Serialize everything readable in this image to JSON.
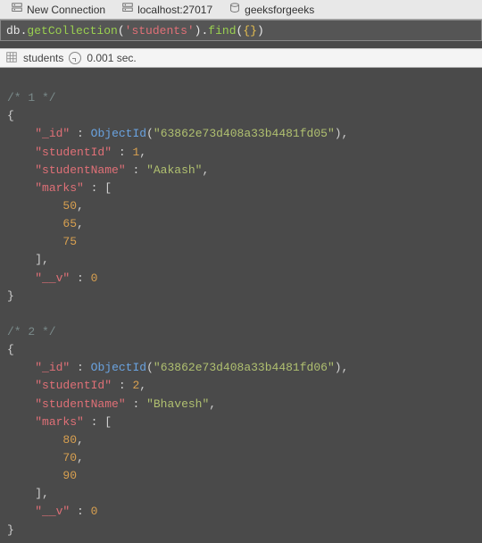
{
  "toolbar": {
    "new_connection": "New Connection",
    "host": "localhost:27017",
    "database": "geeksforgeeks"
  },
  "query": {
    "prefix": "db",
    "dot1": ".",
    "getcol": "getCollection",
    "p_open1": "(",
    "coll_q": "'students'",
    "p_close1": ")",
    "dot2": ".",
    "find": "find",
    "p_open2": "(",
    "braces": "{}",
    "p_close2": ")"
  },
  "status": {
    "collection": "students",
    "time": "0.001 sec."
  },
  "results": {
    "doc1": {
      "comment": "/* 1 */",
      "id_key": "\"_id\"",
      "id_func": "ObjectId",
      "id_val": "\"63862e73d408a33b4481fd05\"",
      "sid_key": "\"studentId\"",
      "sid_val": "1",
      "name_key": "\"studentName\"",
      "name_val": "\"Aakash\"",
      "marks_key": "\"marks\"",
      "m0": "50",
      "m1": "65",
      "m2": "75",
      "v_key": "\"__v\"",
      "v_val": "0"
    },
    "doc2": {
      "comment": "/* 2 */",
      "id_key": "\"_id\"",
      "id_func": "ObjectId",
      "id_val": "\"63862e73d408a33b4481fd06\"",
      "sid_key": "\"studentId\"",
      "sid_val": "2",
      "name_key": "\"studentName\"",
      "name_val": "\"Bhavesh\"",
      "marks_key": "\"marks\"",
      "m0": "80",
      "m1": "70",
      "m2": "90",
      "v_key": "\"__v\"",
      "v_val": "0"
    }
  }
}
